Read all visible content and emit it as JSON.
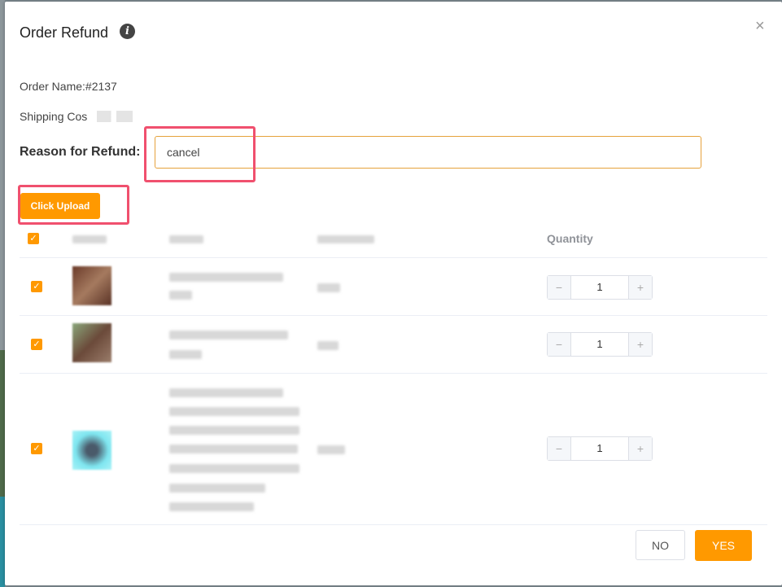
{
  "dialog": {
    "title": "Order Refund",
    "info_icon_glyph": "i",
    "close_glyph": "×",
    "order_name": "Order Name:#2137",
    "shipping_label": "Shipping Cos",
    "reason_label": "Reason for Refund:",
    "reason_value": "cancel",
    "upload_label": "Click Upload"
  },
  "table": {
    "quantity_header": "Quantity",
    "rows": [
      {
        "quantity": "1",
        "thumb_color": "#8a5a44"
      },
      {
        "quantity": "1",
        "thumb_color": "#7f8f6a"
      },
      {
        "quantity": "1",
        "thumb_color": "#7fe6f0"
      }
    ],
    "minus_glyph": "−",
    "plus_glyph": "+",
    "check_glyph": "✓"
  },
  "footer": {
    "no_label": "NO",
    "yes_label": "YES"
  },
  "colors": {
    "accent": "#ff9900",
    "highlight": "#f0506e"
  }
}
